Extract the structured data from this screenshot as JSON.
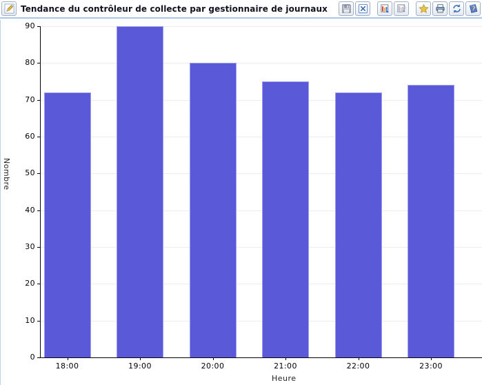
{
  "header": {
    "title": "Tendance du contrôleur de collecte par gestionnaire de journaux",
    "title_edit_icon": "pencil-icon",
    "toolbar_icons": [
      "save-icon",
      "close-icon",
      "chart-edit-icon",
      "chart-clear-icon",
      "star-favorite-icon",
      "printer-icon",
      "refresh-icon",
      "help-book-icon"
    ]
  },
  "chart_data": {
    "type": "bar",
    "title": "Tendance du contrôleur de collecte par gestionnaire de journaux",
    "categories": [
      "18:00",
      "19:00",
      "20:00",
      "21:00",
      "22:00",
      "23:00"
    ],
    "values": [
      72,
      90,
      80,
      75,
      72,
      74
    ],
    "xlabel": "Heure",
    "ylabel": "Nombre",
    "ylim": [
      0,
      90
    ],
    "ytick_step": 10,
    "yticks": [
      0,
      10,
      20,
      30,
      40,
      50,
      60,
      70,
      80,
      90
    ],
    "grid": "horizontal",
    "legend": "none",
    "bar_color": "#5a5ad8",
    "bar_border_color": "#9e9eee",
    "grid_color": "#ececec",
    "axis_color": "#000000"
  }
}
